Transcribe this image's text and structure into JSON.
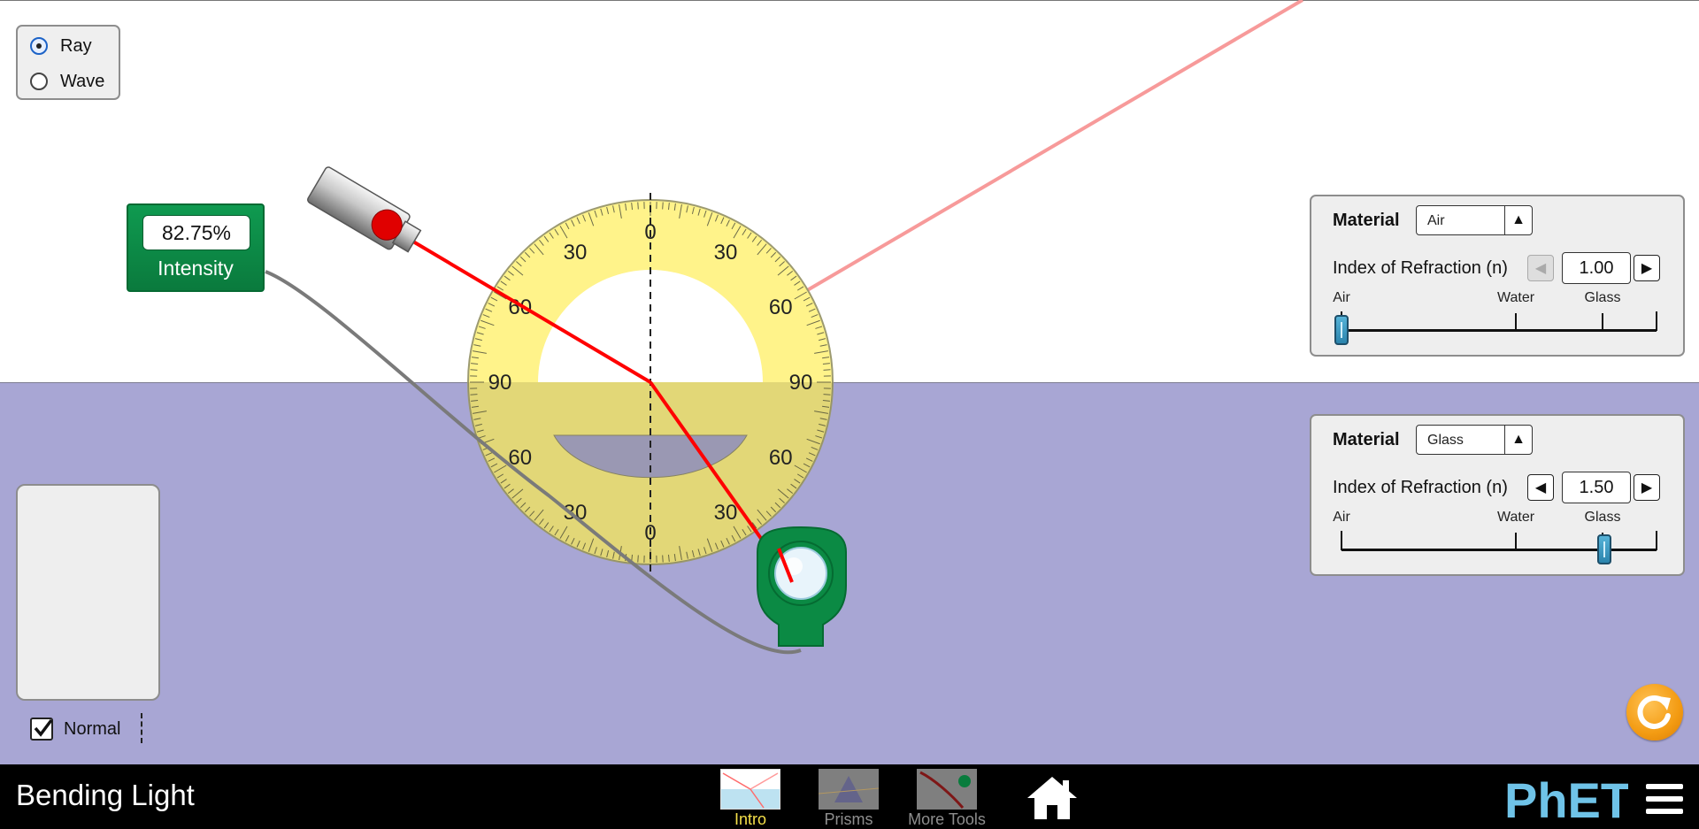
{
  "app": {
    "title": "Bending Light"
  },
  "mode": {
    "options": [
      {
        "label": "Ray",
        "selected": true
      },
      {
        "label": "Wave",
        "selected": false
      }
    ]
  },
  "intensity_meter": {
    "reading": "82.75%",
    "label": "Intensity"
  },
  "protractor": {
    "tick_labels": [
      "0",
      "30",
      "30",
      "60",
      "60",
      "90",
      "90",
      "60",
      "60",
      "30",
      "30",
      "0"
    ]
  },
  "material_panels": {
    "top": {
      "title": "Material",
      "material": "Air",
      "ior_label": "Index of Refraction (n)",
      "ior_value": "1.00",
      "slider_labels": [
        "Air",
        "Water",
        "Glass"
      ],
      "slider_fraction": 0.0
    },
    "bottom": {
      "title": "Material",
      "material": "Glass",
      "ior_label": "Index of Refraction (n)",
      "ior_value": "1.50",
      "slider_labels": [
        "Air",
        "Water",
        "Glass"
      ],
      "slider_fraction": 0.833
    }
  },
  "normal_toggle": {
    "label": "Normal",
    "checked": true
  },
  "navbar": {
    "screens": [
      {
        "label": "Intro",
        "active": true
      },
      {
        "label": "Prisms",
        "active": false
      },
      {
        "label": "More Tools",
        "active": false
      }
    ],
    "logo_text": "PhET"
  },
  "colors": {
    "top_medium": "#ffffff",
    "bottom_medium": "#a8a6d4",
    "incident_ray": "#ff0000",
    "reflected_ray": "#f79a9a",
    "protractor": "#fff38a",
    "meter_green": "#0f9a50",
    "reset_orange": "#f39b12",
    "phet_blue": "#6fc3e8",
    "active_tab": "#f5e04a"
  },
  "icons": [
    "radio-icon",
    "laser-icon",
    "intensity-probe-icon",
    "home-icon",
    "reset-icon",
    "menu-icon",
    "checkbox-check-icon"
  ]
}
